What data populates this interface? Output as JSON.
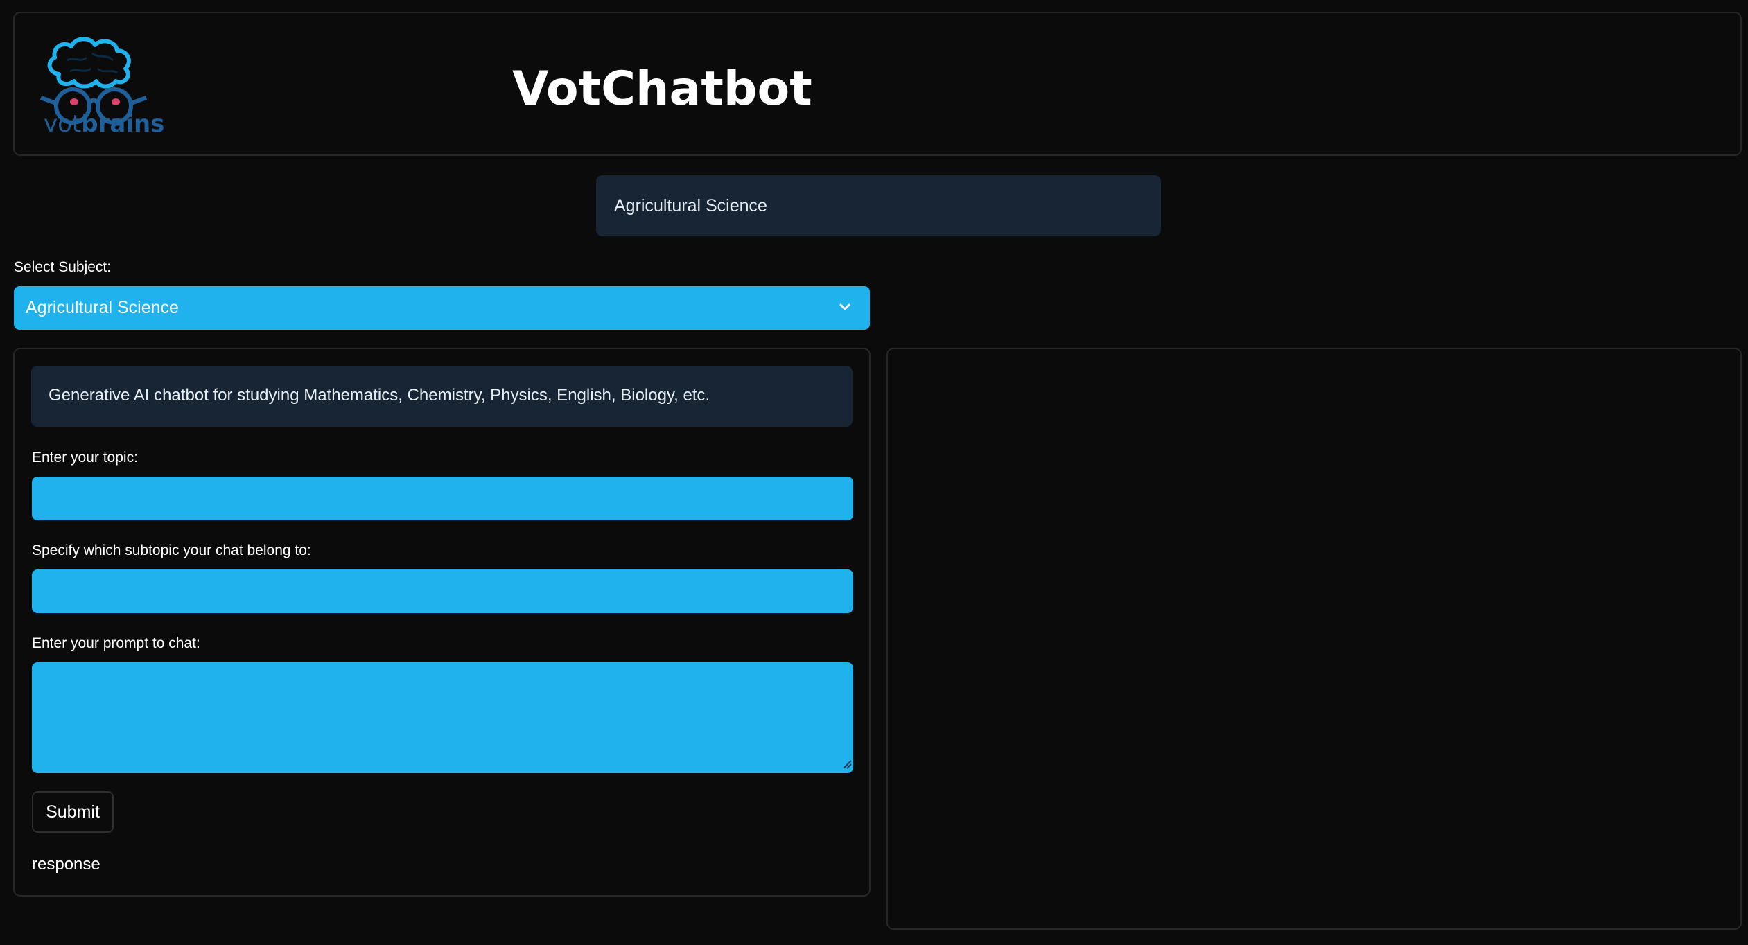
{
  "header": {
    "logo_text_light": "vot",
    "logo_text_bold": "brains",
    "app_title": "VotChatbot"
  },
  "subject_display": "Agricultural Science",
  "subject_select": {
    "label": "Select Subject:",
    "selected": "Agricultural Science"
  },
  "form": {
    "info": "Generative AI chatbot for studying Mathematics, Chemistry, Physics, English, Biology, etc.",
    "topic_label": "Enter your topic:",
    "topic_value": "",
    "subtopic_label": "Specify which subtopic your chat belong to:",
    "subtopic_value": "",
    "prompt_label": "Enter your prompt to chat:",
    "prompt_value": "",
    "submit_label": "Submit",
    "response_label": "response"
  },
  "colors": {
    "background": "#0b0b0b",
    "accent": "#1fb2ec",
    "info_box": "#172535",
    "border": "#262626"
  }
}
